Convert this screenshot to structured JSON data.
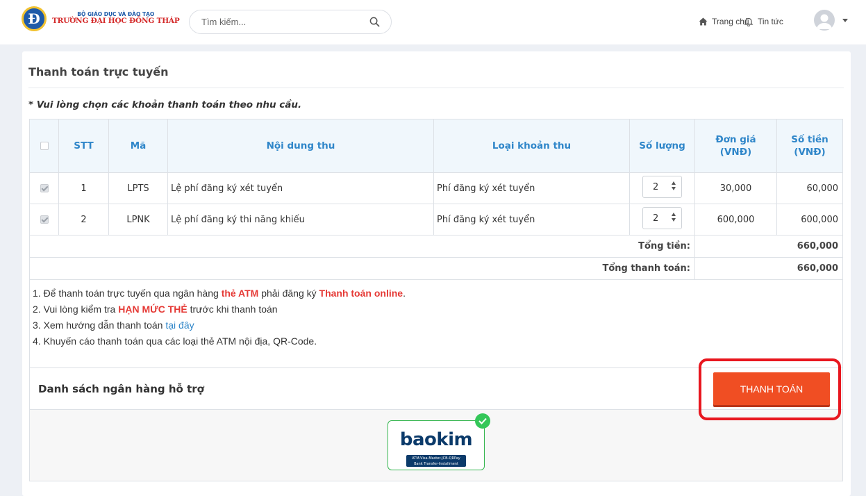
{
  "header": {
    "logo_sub": "BỘ GIÁO DỤC VÀ ĐÀO TẠO",
    "logo_main": "TRƯỜNG ĐẠI HỌC ĐỒNG THÁP",
    "search_placeholder": "Tìm kiếm...",
    "nav_home": "Trang chủ",
    "nav_news": "Tin tức"
  },
  "page": {
    "title": "Thanh toán trực tuyến",
    "note": "* Vui lòng chọn các khoản thanh toán theo nhu cầu."
  },
  "table": {
    "headers": {
      "stt": "STT",
      "code": "Mã",
      "content": "Nội dung thu",
      "type": "Loại khoản thu",
      "qty": "Số lượng",
      "unit_price_1": "Đơn giá",
      "unit_price_2": "(VNĐ)",
      "amount_1": "Số tiền",
      "amount_2": "(VNĐ)"
    },
    "rows": [
      {
        "checked": true,
        "stt": "1",
        "code": "LPTS",
        "content": "Lệ phí đăng ký xét tuyển",
        "type": "Phí đăng ký xét tuyển",
        "qty": "2",
        "unit_price": "30,000",
        "amount": "60,000"
      },
      {
        "checked": true,
        "stt": "2",
        "code": "LPNK",
        "content": "Lệ phí đăng ký thi năng khiếu",
        "type": "Phí đăng ký xét tuyển",
        "qty": "2",
        "unit_price": "600,000",
        "amount": "600,000"
      }
    ],
    "total_label": "Tổng tiền:",
    "total_value": "660,000",
    "grand_total_label": "Tổng thanh toán:",
    "grand_total_value": "660,000"
  },
  "info": {
    "line1_a": "1. Để thanh toán trực tuyến qua ngân hàng ",
    "line1_b": "thẻ ATM",
    "line1_c": " phải đăng ký ",
    "line1_d": "Thanh toán online",
    "line1_e": ".",
    "line2_a": "2. Vui lòng kiểm tra ",
    "line2_b": "HẠN MỨC THẺ",
    "line2_c": " trước khi thanh toán",
    "line3_a": "3. Xem hướng dẫn thanh toán ",
    "line3_link": "tại đây",
    "line4": "4. Khuyến cáo thanh toán qua các loại thẻ ATM nội địa, QR-Code."
  },
  "bank": {
    "title": "Danh sách ngân hàng hỗ trợ",
    "pay_button": "THANH TOÁN",
    "provider_name": "baokim",
    "provider_tagline_1": "ATM-Visa-Master-JCB-QRPay",
    "provider_tagline_2": "Bank Transfer-Installment"
  },
  "colors": {
    "accent": "#2f86c9",
    "pay_button": "#f04e23",
    "highlight": "#e8171f",
    "warning_text": "#e53935"
  }
}
